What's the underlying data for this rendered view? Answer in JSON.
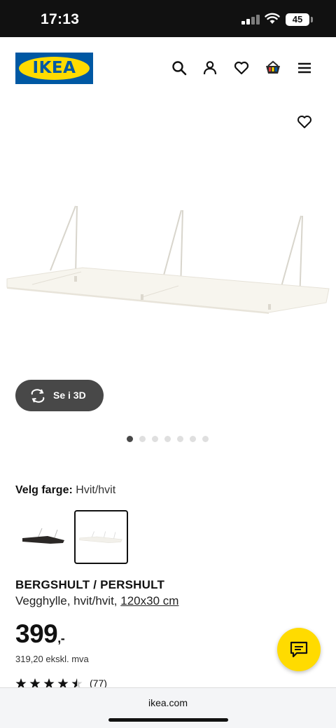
{
  "status_bar": {
    "time": "17:13",
    "battery": "45"
  },
  "header": {
    "logo": "IKEA",
    "icons": [
      "search-icon",
      "account-icon",
      "wishlist-icon",
      "cart-icon",
      "menu-icon"
    ]
  },
  "gallery": {
    "favorite_icon": "heart-icon",
    "view_3d_label": "Se i 3D",
    "image_count": 7,
    "active_image": 1
  },
  "color_picker": {
    "label": "Velg farge:",
    "selected": "Hvit/hvit",
    "swatches": [
      "black-brown",
      "white"
    ]
  },
  "product": {
    "name": "BERGSHULT / PERSHULT",
    "description": "Vegghylle, hvit/hvit,",
    "size": "120x30 cm",
    "price": "399",
    "price_suffix": ",-",
    "price_excl_vat": "319,20 ekskl. mva",
    "rating": 4.5,
    "review_count": "(77)"
  },
  "chat": {
    "icon": "chat-icon"
  },
  "browser": {
    "url": "ikea.com"
  },
  "colors": {
    "ikea_blue": "#0058a3",
    "ikea_yellow": "#ffdb00",
    "dark_button": "#484848"
  }
}
